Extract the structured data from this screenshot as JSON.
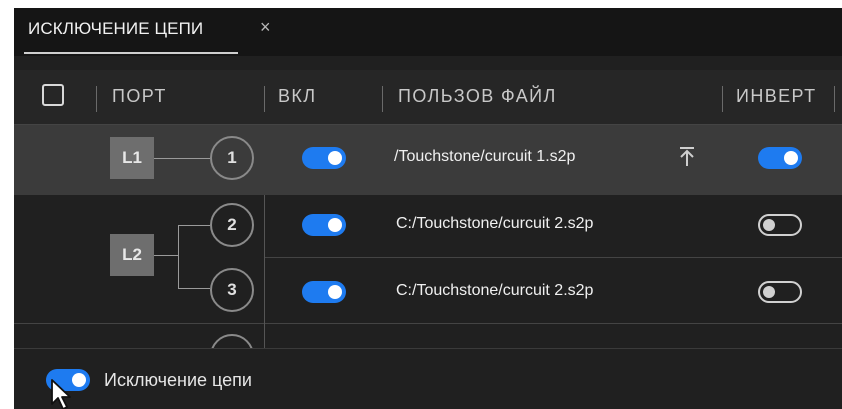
{
  "tab": {
    "label": "ИСКЛЮЧЕНИЕ ЦЕПИ",
    "close_glyph": "×"
  },
  "table": {
    "headers": {
      "port": "ПОРТ",
      "enable": "ВКЛ",
      "user_file": "ПОЛЬЗОВ ФАЙЛ",
      "invert": "ИНВЕРТ"
    },
    "select_all_checked": false,
    "groups": [
      {
        "line": "L1",
        "ports": [
          {
            "port": "1",
            "enabled": true,
            "file": "/Touchstone/curcuit 1.s2p",
            "invert": true,
            "selected": true,
            "upload_icon": "upload-icon"
          }
        ]
      },
      {
        "line": "L2",
        "ports": [
          {
            "port": "2",
            "enabled": true,
            "file": "C:/Touchstone/curcuit 2.s2p",
            "invert": false
          },
          {
            "port": "3",
            "enabled": true,
            "file": "C:/Touchstone/curcuit 2.s2p",
            "invert": false
          }
        ]
      }
    ]
  },
  "footer": {
    "label": "Исключение цепи",
    "enabled": true
  },
  "colors": {
    "accent": "#1e7bf0",
    "background": "#202020",
    "row_highlight": "#3b3b3b",
    "text": "#e6e6e6"
  },
  "icons": {
    "close": "close-icon",
    "upload": "upload-icon",
    "cursor": "mouse-pointer-icon"
  }
}
